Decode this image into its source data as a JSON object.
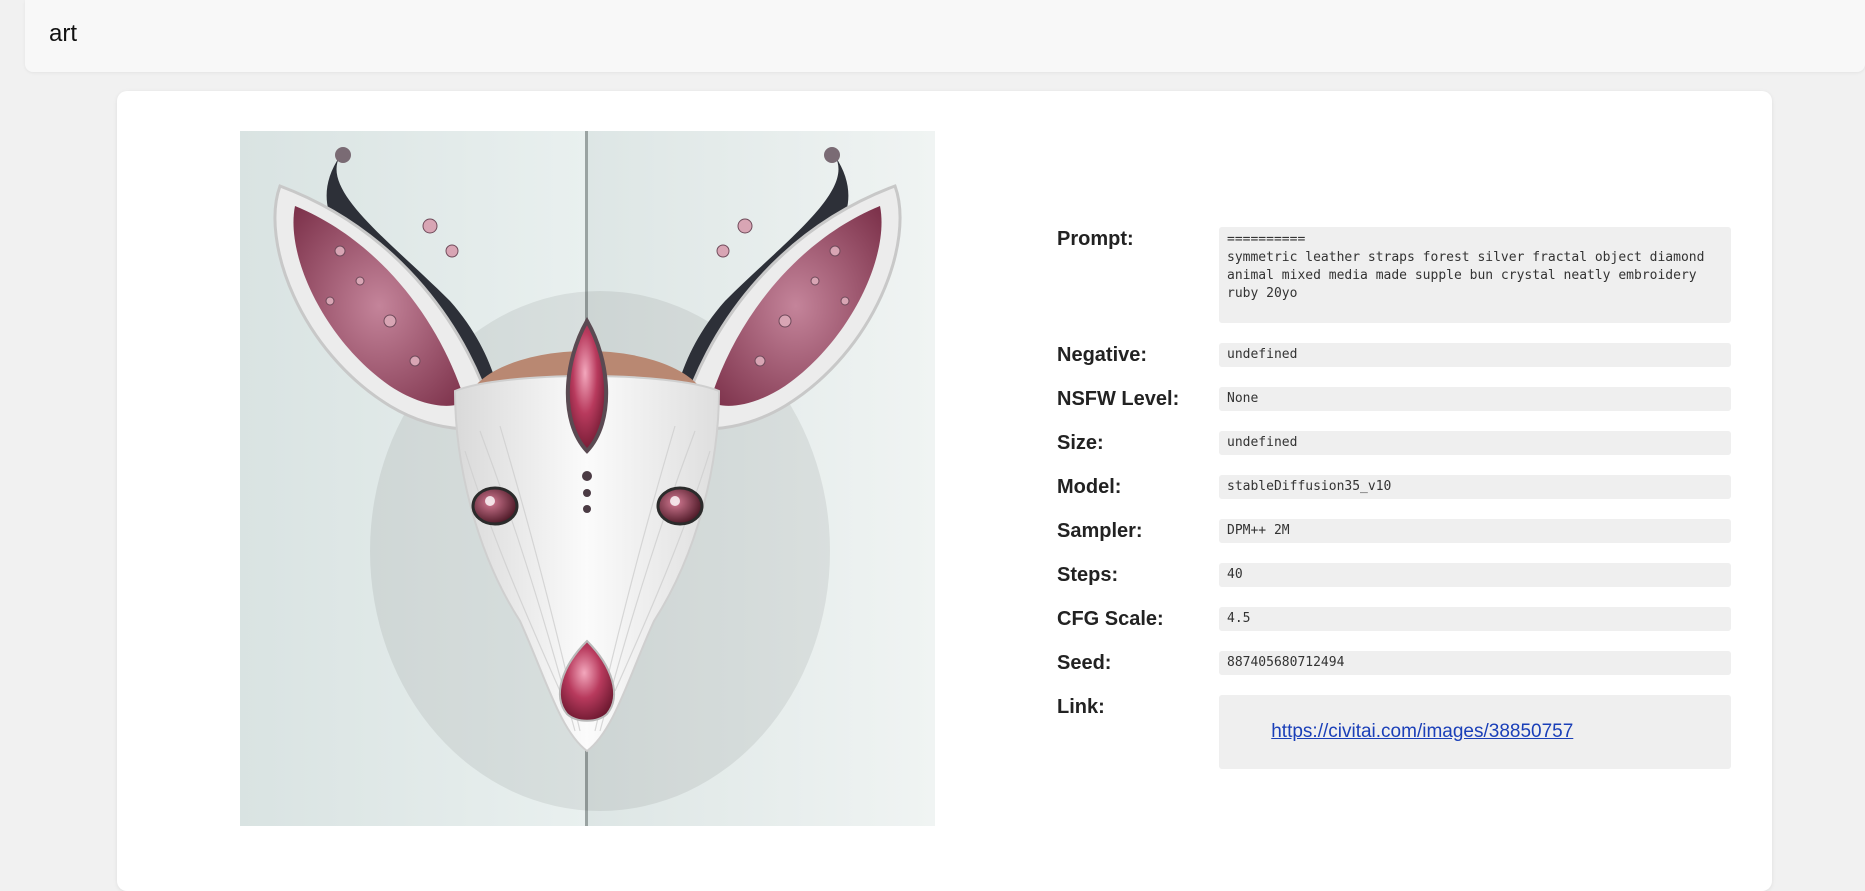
{
  "header": {
    "title": "art"
  },
  "image": {
    "subject_icon": "jeweled-deer-mask-artwork",
    "background_color": "#dfe9e8",
    "accent_color": "#9c2f4e"
  },
  "details": {
    "prompt": {
      "label": "Prompt:",
      "value": "==========\nsymmetric leather straps forest silver fractal object diamond animal mixed media made supple bun crystal neatly embroidery ruby 20yo"
    },
    "negative": {
      "label": "Negative:",
      "value": "undefined"
    },
    "nsfw": {
      "label": "NSFW Level:",
      "value": "None"
    },
    "size": {
      "label": "Size:",
      "value": "undefined"
    },
    "model": {
      "label": "Model:",
      "value": "stableDiffusion35_v10"
    },
    "sampler": {
      "label": "Sampler:",
      "value": "DPM++ 2M"
    },
    "steps": {
      "label": "Steps:",
      "value": "40"
    },
    "cfg": {
      "label": "CFG Scale:",
      "value": "4.5"
    },
    "seed": {
      "label": "Seed:",
      "value": "887405680712494"
    },
    "link": {
      "label": "Link:",
      "value": "https://civitai.com/images/38850757"
    }
  }
}
